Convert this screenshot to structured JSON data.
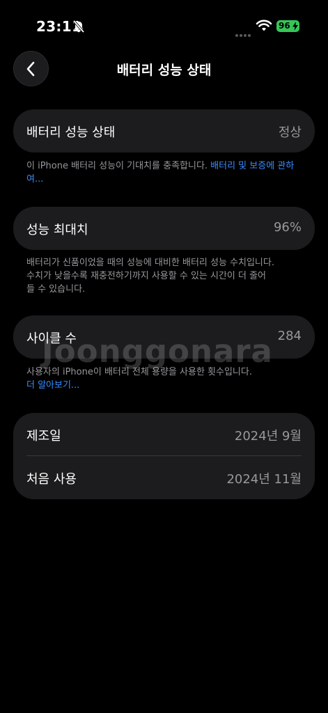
{
  "status_bar": {
    "time": "23:11",
    "battery_level": "96",
    "battery_color": "#34c759"
  },
  "nav": {
    "title": "배터리 성능 상태"
  },
  "battery_health": {
    "label": "배터리 성능 상태",
    "value": "정상"
  },
  "battery_health_note": {
    "text": "이 iPhone 배터리 성능이 기대치를 충족합니다. ",
    "link": "배터리 및 보증에 관하여..."
  },
  "max_capacity": {
    "label": "성능 최대치",
    "value": "96%"
  },
  "max_capacity_note": {
    "line1": "배터리가 신품이었을 때의 성능에 대비한 배터리 성능 수치입니다.",
    "line2": "수치가 낮을수록 재충전하기까지 사용할 수 있는 시간이 더 줄어",
    "line3": "들 수 있습니다."
  },
  "cycle_count": {
    "label": "사이클 수",
    "value": "284"
  },
  "cycle_count_note": {
    "text": "사용자의 iPhone이 배터리 전체 용량을 사용한 횟수입니다.",
    "link": "더 알아보기..."
  },
  "dates": {
    "manufacture": {
      "label": "제조일",
      "value": "2024년 9월"
    },
    "first_use": {
      "label": "처음 사용",
      "value": "2024년 11월"
    }
  },
  "watermark": "Joonggonara",
  "colors": {
    "link": "#3a8cff",
    "card": "#1c1c1e",
    "secondary_text": "#98989d"
  }
}
